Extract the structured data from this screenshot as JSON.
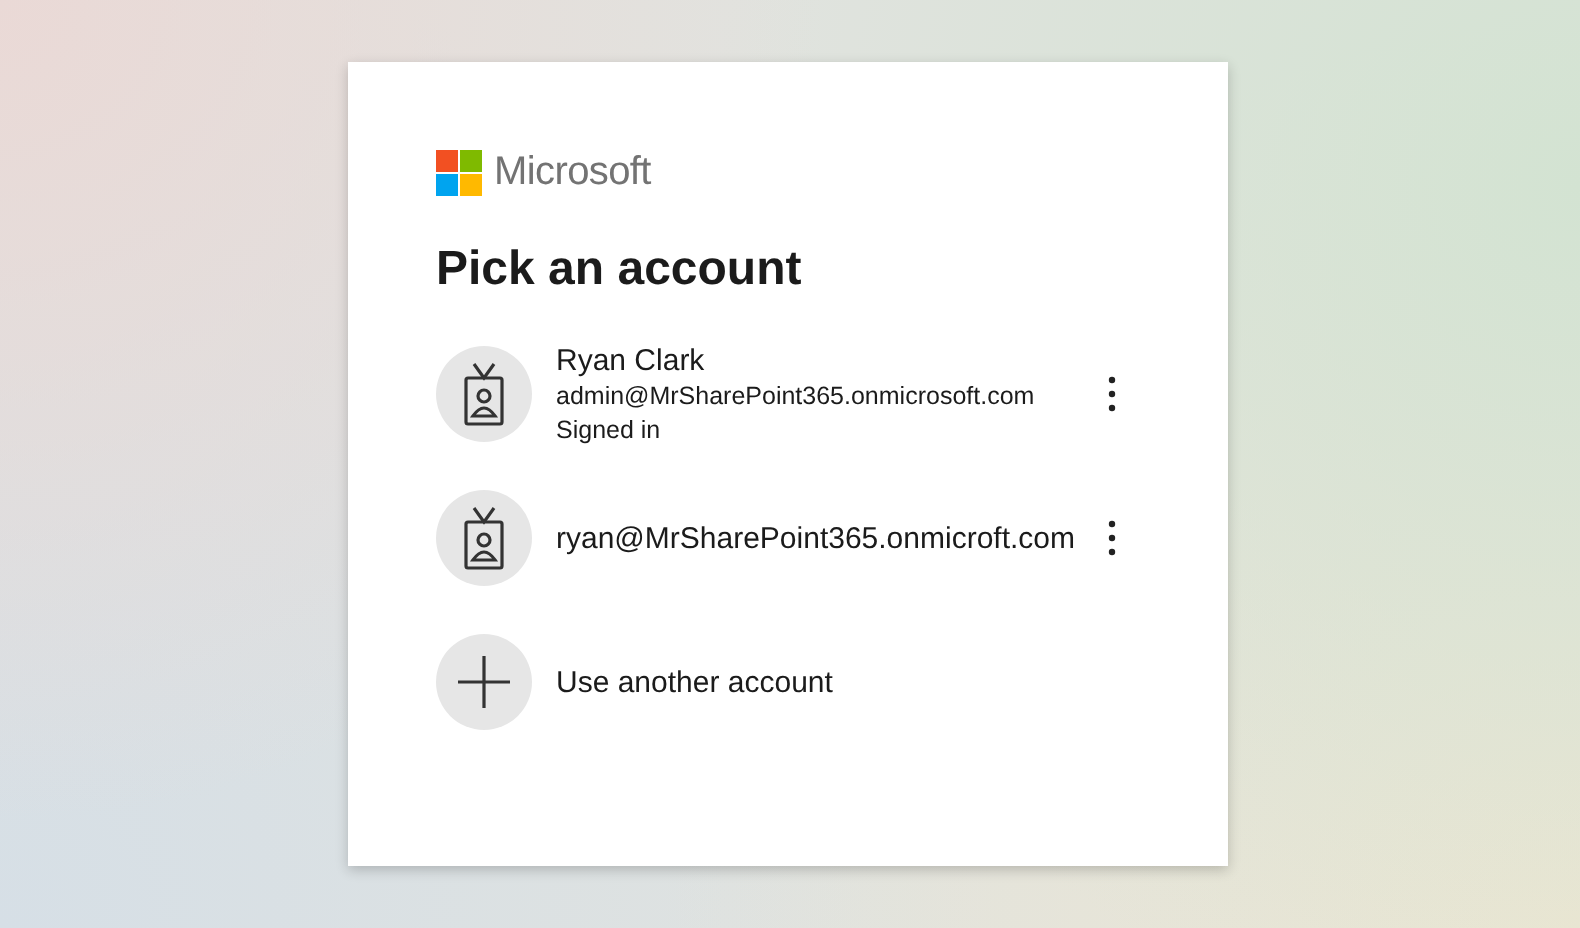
{
  "logo": {
    "text": "Microsoft"
  },
  "heading": "Pick an account",
  "accounts": [
    {
      "kind": "account",
      "name": "Ryan Clark",
      "email": "admin@MrSharePoint365.onmicrosoft.com",
      "status": "Signed in"
    },
    {
      "kind": "account",
      "email": "ryan@MrSharePoint365.onmicroft.com"
    },
    {
      "kind": "add",
      "label": "Use another account"
    }
  ]
}
